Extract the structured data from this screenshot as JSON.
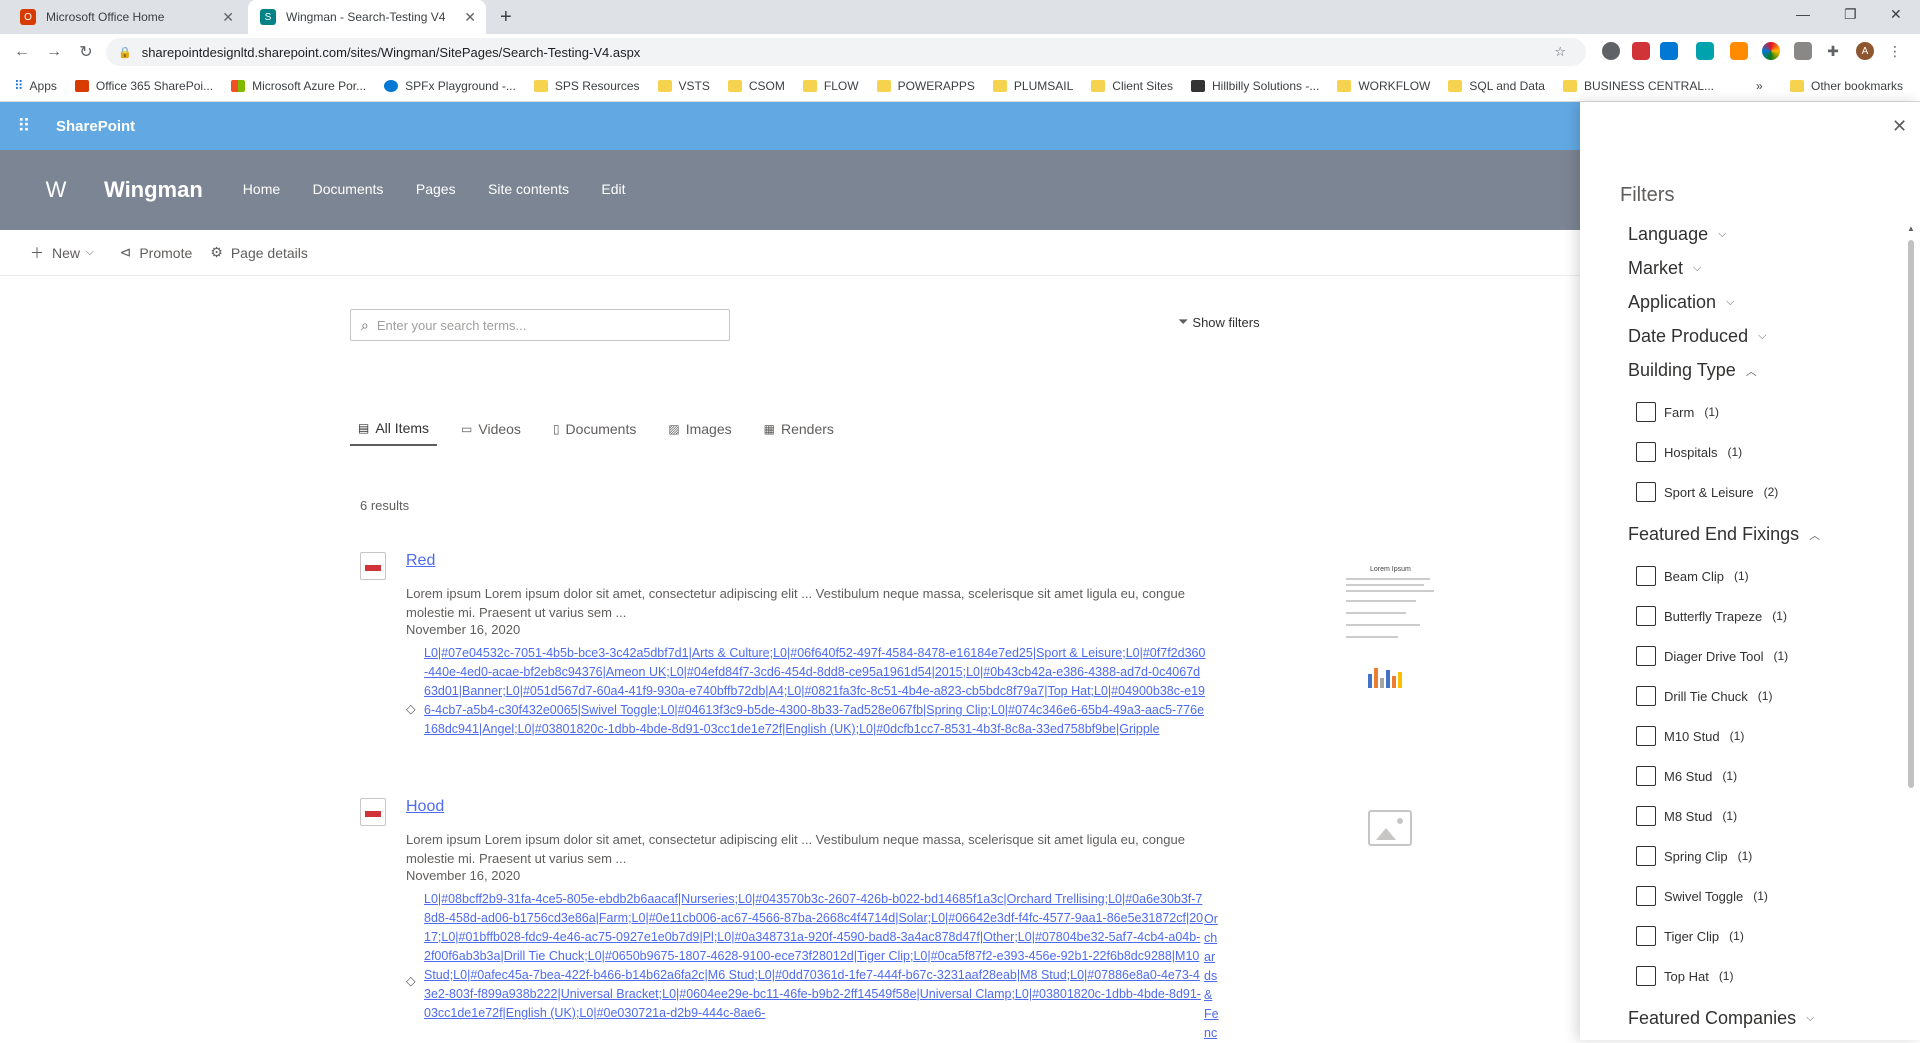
{
  "browser": {
    "tabs": [
      {
        "label": "Microsoft Office Home"
      },
      {
        "label": "Wingman - Search-Testing V4"
      }
    ],
    "url": "sharepointdesignltd.sharepoint.com/sites/Wingman/SitePages/Search-Testing-V4.aspx",
    "avatar_letter": "A"
  },
  "bookmarks": {
    "items": [
      "Apps",
      "Office 365 SharePoi...",
      "Microsoft Azure Por...",
      "SPFx Playground -...",
      "SPS Resources",
      "VSTS",
      "CSOM",
      "FLOW",
      "POWERAPPS",
      "PLUMSAIL",
      "Client Sites",
      "Hillbilly Solutions -...",
      "WORKFLOW",
      "SQL and Data",
      "BUSINESS CENTRAL..."
    ],
    "overflow": "»",
    "other": "Other bookmarks"
  },
  "suitebar": {
    "brand": "SharePoint"
  },
  "site": {
    "logo_letter": "W",
    "title": "Wingman",
    "nav": [
      "Home",
      "Documents",
      "Pages",
      "Site contents",
      "Edit"
    ]
  },
  "commandbar": {
    "new": "New",
    "promote": "Promote",
    "page_details": "Page details"
  },
  "search": {
    "placeholder": "Enter your search terms...",
    "show_filters": "Show filters",
    "tabs": [
      "All Items",
      "Videos",
      "Documents",
      "Images",
      "Renders"
    ],
    "result_count": "6 results"
  },
  "results": [
    {
      "title": "Red",
      "summary": "Lorem ipsum Lorem ipsum dolor sit amet, consectetur adipiscing elit ... Vestibulum neque massa, scelerisque sit amet ligula eu, congue molestie mi. Praesent ut varius sem ...",
      "date": "November 16, 2020",
      "tags": "L0|#07e04532c-7051-4b5b-bce3-3c42a5dbf7d1|Arts & Culture;L0|#06f640f52-497f-4584-8478-e16184e7ed25|Sport & Leisure;L0|#0f7f2d360-440e-4ed0-acae-bf2eb8c94376|Ameon UK;L0|#04efd84f7-3cd6-454d-8dd8-ce95a1961d54|2015;L0|#0b43cb42a-e386-4388-ad7d-0c4067d63d01|Banner;L0|#051d567d7-60a4-41f9-930a-e740bffb72db|A4;L0|#0821fa3fc-8c51-4b4e-a823-cb5bdc8f79a7|Top Hat;L0|#04900b38c-e196-4cb7-a5b4-c30f432e0065|Swivel Toggle;L0|#04613f3c9-b5de-4300-8b33-7ad528e067fb|Spring Clip;L0|#074c346e6-65b4-49a3-aac5-776e168dc941|Angel;L0|#03801820c-1dbb-4bde-8d91-03cc1de1e72f|English (UK);L0|#0dcfb1cc7-8531-4b3f-8c8a-33ed758bf9be|Gripple",
      "thumbnail_title": "Lorem Ipsum"
    },
    {
      "title": "Hood",
      "summary": "Lorem ipsum Lorem ipsum dolor sit amet, consectetur adipiscing elit ... Vestibulum neque massa, scelerisque sit amet ligula eu, congue molestie mi. Praesent ut varius sem ...",
      "date": "November 16, 2020",
      "tags": "L0|#08bcff2b9-31fa-4ce5-805e-ebdb2b6aacaf|Nurseries;L0|#043570b3c-2607-426b-b022-bd14685f1a3c|Orchard Trellising;L0|#0a6e30b3f-78d8-458d-ad06-b1756cd3e86a|Farm;L0|#0e11cb006-ac67-4566-87ba-2668c4f4714d|Solar;L0|#06642e3df-f4fc-4577-9aa1-86e5e31872cf|2017;L0|#01bffb028-fdc9-4e46-ac75-0927e1e0b7d9|Pl;L0|#0a348731a-920f-4590-bad8-3a4ac878d47f|Other;L0|#07804be32-5af7-4cb4-a04b-2f00f6ab3b3a|Drill Tie Chuck;L0|#0650b9675-1807-4628-9100-ece73f28012d|Tiger Clip;L0|#0ca5f87f2-e393-456e-92b1-22f6b8dc9288|M10 Stud;L0|#0afec45a-7bea-422f-b466-b14b62a6fa2c|M6 Stud;L0|#0dd70361d-1fe7-444f-b67c-3231aaf28eab|M8 Stud;L0|#07886e8a0-4e73-43e2-803f-f899a938b222|Universal Bracket;L0|#0604ee29e-bc11-46fe-b9b2-2ff14549f58e|Universal Clamp;L0|#03801820c-1dbb-4bde-8d91-03cc1de1e72f|English (UK);L0|#0e030721a-d2b9-444c-8ae6-",
      "side_tag": "Orchards & Fenc"
    }
  ],
  "filters": {
    "heading": "Filters",
    "groups": [
      "Language",
      "Market",
      "Application",
      "Date Produced",
      "Building Type",
      "Featured End Fixings",
      "Featured Companies"
    ],
    "building_type": [
      {
        "label": "Farm",
        "count": "(1)"
      },
      {
        "label": "Hospitals",
        "count": "(1)"
      },
      {
        "label": "Sport & Leisure",
        "count": "(2)"
      }
    ],
    "end_fixings": [
      {
        "label": "Beam Clip",
        "count": "(1)"
      },
      {
        "label": "Butterfly Trapeze",
        "count": "(1)"
      },
      {
        "label": "Diager Drive Tool",
        "count": "(1)"
      },
      {
        "label": "Drill Tie Chuck",
        "count": "(1)"
      },
      {
        "label": "M10 Stud",
        "count": "(1)"
      },
      {
        "label": "M6 Stud",
        "count": "(1)"
      },
      {
        "label": "M8 Stud",
        "count": "(1)"
      },
      {
        "label": "Spring Clip",
        "count": "(1)"
      },
      {
        "label": "Swivel Toggle",
        "count": "(1)"
      },
      {
        "label": "Tiger Clip",
        "count": "(1)"
      },
      {
        "label": "Top Hat",
        "count": "(1)"
      }
    ]
  }
}
